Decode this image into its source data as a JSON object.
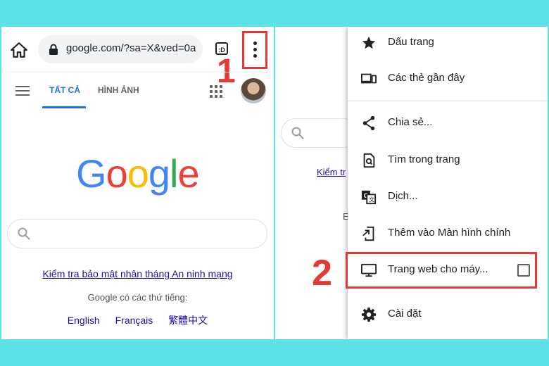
{
  "left": {
    "url": "google.com/?sa=X&ved=0a",
    "tabs_icon_text": ":D",
    "step_label": "1",
    "nav": {
      "tab_all": "TẤT CẢ",
      "tab_images": "HÌNH ẢNH"
    },
    "logo_letters": [
      "G",
      "o",
      "o",
      "g",
      "l",
      "e"
    ],
    "security_link": "Kiểm tra bảo mật nhân tháng An ninh mạng",
    "offered_in": "Google có các thứ tiếng:",
    "languages": [
      "English",
      "Français",
      "繁體中文"
    ]
  },
  "right": {
    "step_label": "2",
    "bg_link_fragment": "Kiểm tr",
    "bg_text_fragment": "E",
    "menu": [
      {
        "label": "Dấu trang",
        "icon": "star-icon"
      },
      {
        "label": "Các thẻ gần đây",
        "icon": "devices-icon"
      },
      {
        "label": "Chia sẻ...",
        "icon": "share-icon"
      },
      {
        "label": "Tìm trong trang",
        "icon": "find-in-page-icon"
      },
      {
        "label": "Dịch...",
        "icon": "translate-icon"
      },
      {
        "label": "Thêm vào Màn hình chính",
        "icon": "add-to-home-icon"
      },
      {
        "label": "Trang web cho máy...",
        "icon": "desktop-icon"
      },
      {
        "label": "Cài đặt",
        "icon": "settings-gear-icon"
      }
    ]
  },
  "colors": {
    "background": "#5ce1e6",
    "highlight_red": "#e53935",
    "google_blue": "#4285f4",
    "google_red": "#ea4335",
    "google_yellow": "#fbbc05",
    "google_green": "#34a853",
    "link_blue": "#1a0dab",
    "tab_active": "#1a73e8"
  }
}
